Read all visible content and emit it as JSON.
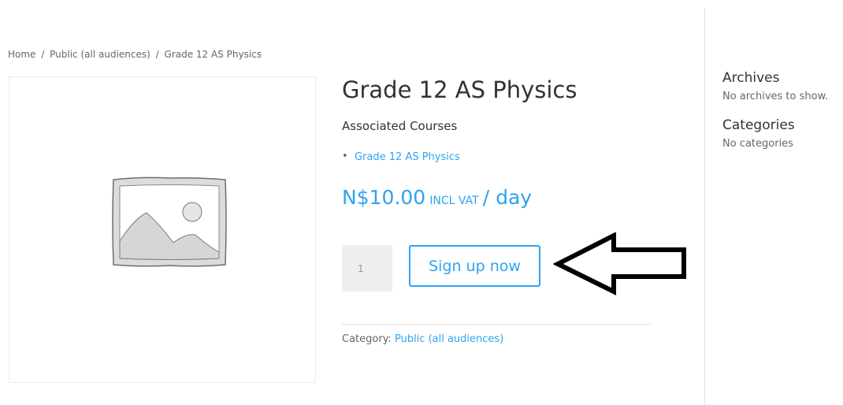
{
  "breadcrumb": {
    "items": [
      "Home",
      "Public (all audiences)",
      "Grade 12 AS Physics"
    ],
    "separator": "/"
  },
  "product": {
    "image_icon": "placeholder-image-icon",
    "title": "Grade 12 AS Physics",
    "associated_label": "Associated Courses",
    "courses": [
      "Grade 12 AS Physics"
    ],
    "price": {
      "amount": "N$10.00",
      "suffix": "incl VAT",
      "period": "/ day"
    },
    "quantity": "1",
    "signup_label": "Sign up now",
    "category_label": "Category:",
    "category_value": "Public (all audiences)"
  },
  "annotation": {
    "icon": "arrow-left-icon"
  },
  "sidebar": {
    "archives_title": "Archives",
    "archives_text": "No archives to show.",
    "categories_title": "Categories",
    "categories_text": "No categories"
  },
  "colors": {
    "accent": "#2ea3f2",
    "text": "#666666",
    "heading": "#333333",
    "input_bg": "#eeeeee"
  }
}
